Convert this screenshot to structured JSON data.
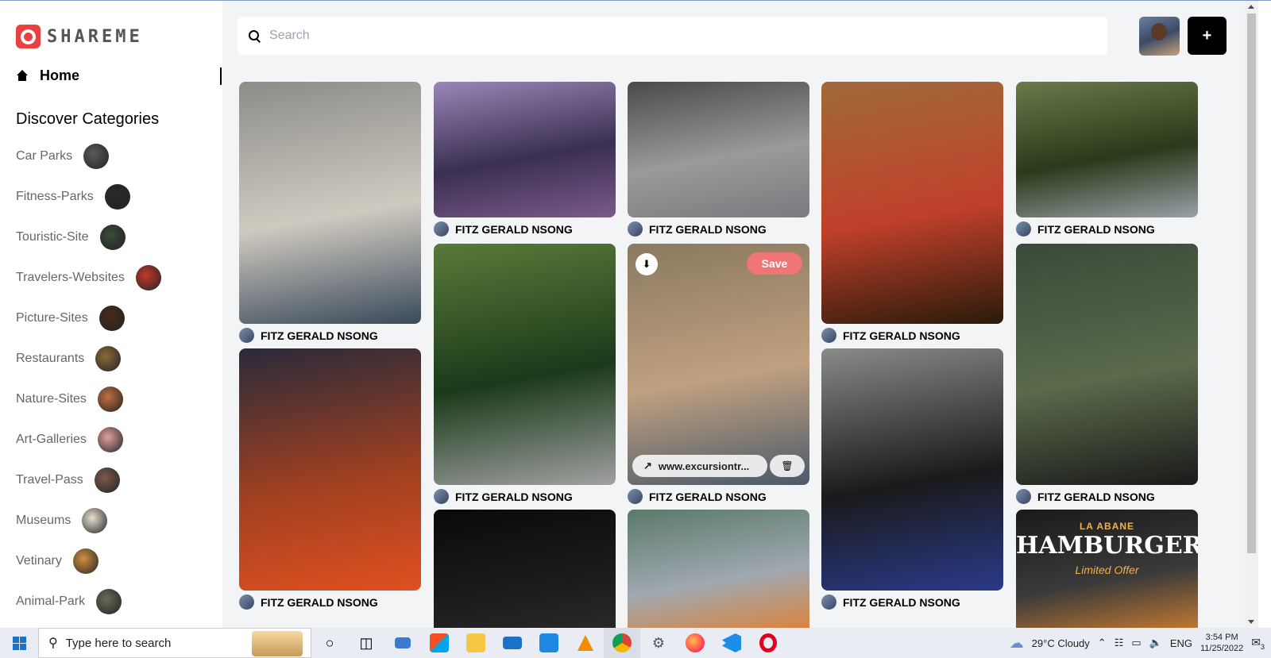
{
  "app": {
    "name": "SHAREME"
  },
  "sidebar": {
    "home_label": "Home",
    "categories_title": "Discover Categories",
    "categories": [
      {
        "label": "Car Parks",
        "color": "#5a5a5a"
      },
      {
        "label": "Fitness-Parks",
        "color": "#2a2a2a"
      },
      {
        "label": "Touristic-Site",
        "color": "#3a4a3a"
      },
      {
        "label": "Travelers-Websites",
        "color": "#c0392b"
      },
      {
        "label": "Picture-Sites",
        "color": "#4a2a1a"
      },
      {
        "label": "Restaurants",
        "color": "#8a6a3a"
      },
      {
        "label": "Nature-Sites",
        "color": "#c07040"
      },
      {
        "label": "Art-Galleries",
        "color": "#e0a0a0"
      },
      {
        "label": "Travel-Pass",
        "color": "#7a5a4a"
      },
      {
        "label": "Museums",
        "color": "#e8e0d0"
      },
      {
        "label": "Vetinary",
        "color": "#d09040"
      },
      {
        "label": "Animal-Park",
        "color": "#6a6a5a"
      }
    ]
  },
  "header": {
    "search_placeholder": "Search",
    "add_label": "+"
  },
  "pins": [
    {
      "author": "FITZ GERALD NSONG",
      "colors": [
        "#8c8c88",
        "#cfcac0",
        "#3a4a5a"
      ]
    },
    {
      "author": "FITZ GERALD NSONG",
      "colors": [
        "#9a86b8",
        "#3a3050",
        "#7a5a8a"
      ]
    },
    {
      "author": "FITZ GERALD NSONG",
      "colors": [
        "#4a4a48",
        "#9a9a98",
        "#7a7a80"
      ]
    },
    {
      "author": "FITZ GERALD NSONG",
      "colors": [
        "#a06a3a",
        "#c0402a",
        "#2a1a0a"
      ]
    },
    {
      "author": "FITZ GERALD NSONG",
      "colors": [
        "#6a7a4a",
        "#2a3a1a",
        "#9aa0a8"
      ]
    },
    {
      "author": "FITZ GERALD NSONG",
      "link": "www.excursiontr...",
      "save_label": "Save",
      "colors": [
        "#8a7a60",
        "#c0a080",
        "#4a5a6a"
      ]
    },
    {
      "author": "FITZ GERALD NSONG",
      "colors": [
        "#5a7a3a",
        "#1a3a1a",
        "#a0a0a0"
      ]
    },
    {
      "author": "FITZ GERALD NSONG",
      "colors": [
        "#2a2a3a",
        "#a04020",
        "#e05020"
      ]
    },
    {
      "author": "FITZ GERALD NSONG",
      "colors": [
        "#8a8a88",
        "#1a1a1a",
        "#2a3a8a"
      ]
    },
    {
      "author": "FITZ GERALD NSONG",
      "colors": [
        "#3a4a3a",
        "#5a6a4a",
        "#1a1a1a"
      ]
    },
    {
      "author": "",
      "colors": [
        "#0a0a0a",
        "#1a1a1a",
        "#2a2a2a"
      ]
    },
    {
      "author": "",
      "colors": [
        "#5a7a6a",
        "#a0a8b0",
        "#e08030"
      ]
    },
    {
      "author": "",
      "title": "LA ABANE",
      "subtitle": "HAMBURGER",
      "tagline": "Limited Offer",
      "colors": [
        "#1a1a1a",
        "#3a3a3a",
        "#d08030"
      ]
    }
  ],
  "taskbar": {
    "search_placeholder": "Type here to search",
    "weather": "29°C  Cloudy",
    "language": "ENG",
    "time": "3:54 PM",
    "date": "11/25/2022",
    "notification_count": "3"
  }
}
